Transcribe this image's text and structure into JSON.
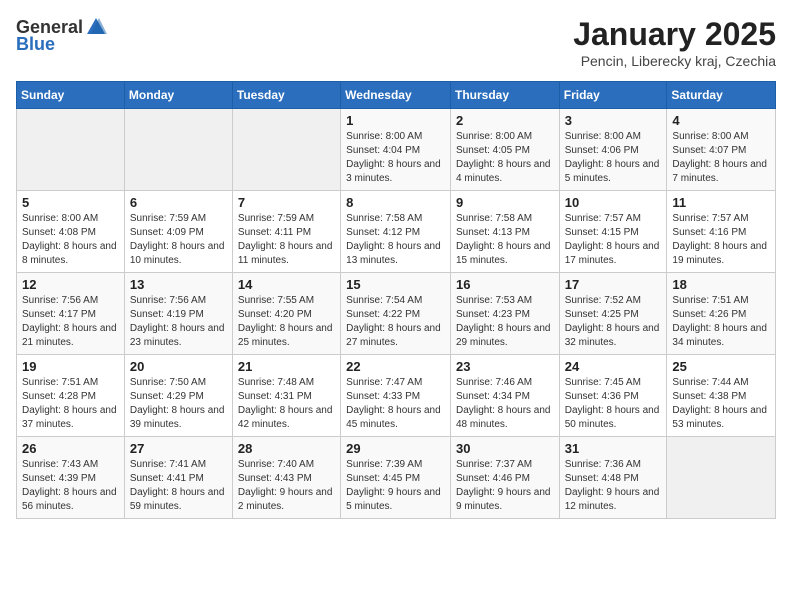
{
  "header": {
    "logo_general": "General",
    "logo_blue": "Blue",
    "month_title": "January 2025",
    "subtitle": "Pencin, Liberecky kraj, Czechia"
  },
  "weekdays": [
    "Sunday",
    "Monday",
    "Tuesday",
    "Wednesday",
    "Thursday",
    "Friday",
    "Saturday"
  ],
  "weeks": [
    [
      {
        "day": "",
        "info": ""
      },
      {
        "day": "",
        "info": ""
      },
      {
        "day": "",
        "info": ""
      },
      {
        "day": "1",
        "info": "Sunrise: 8:00 AM\nSunset: 4:04 PM\nDaylight: 8 hours and 3 minutes."
      },
      {
        "day": "2",
        "info": "Sunrise: 8:00 AM\nSunset: 4:05 PM\nDaylight: 8 hours and 4 minutes."
      },
      {
        "day": "3",
        "info": "Sunrise: 8:00 AM\nSunset: 4:06 PM\nDaylight: 8 hours and 5 minutes."
      },
      {
        "day": "4",
        "info": "Sunrise: 8:00 AM\nSunset: 4:07 PM\nDaylight: 8 hours and 7 minutes."
      }
    ],
    [
      {
        "day": "5",
        "info": "Sunrise: 8:00 AM\nSunset: 4:08 PM\nDaylight: 8 hours and 8 minutes."
      },
      {
        "day": "6",
        "info": "Sunrise: 7:59 AM\nSunset: 4:09 PM\nDaylight: 8 hours and 10 minutes."
      },
      {
        "day": "7",
        "info": "Sunrise: 7:59 AM\nSunset: 4:11 PM\nDaylight: 8 hours and 11 minutes."
      },
      {
        "day": "8",
        "info": "Sunrise: 7:58 AM\nSunset: 4:12 PM\nDaylight: 8 hours and 13 minutes."
      },
      {
        "day": "9",
        "info": "Sunrise: 7:58 AM\nSunset: 4:13 PM\nDaylight: 8 hours and 15 minutes."
      },
      {
        "day": "10",
        "info": "Sunrise: 7:57 AM\nSunset: 4:15 PM\nDaylight: 8 hours and 17 minutes."
      },
      {
        "day": "11",
        "info": "Sunrise: 7:57 AM\nSunset: 4:16 PM\nDaylight: 8 hours and 19 minutes."
      }
    ],
    [
      {
        "day": "12",
        "info": "Sunrise: 7:56 AM\nSunset: 4:17 PM\nDaylight: 8 hours and 21 minutes."
      },
      {
        "day": "13",
        "info": "Sunrise: 7:56 AM\nSunset: 4:19 PM\nDaylight: 8 hours and 23 minutes."
      },
      {
        "day": "14",
        "info": "Sunrise: 7:55 AM\nSunset: 4:20 PM\nDaylight: 8 hours and 25 minutes."
      },
      {
        "day": "15",
        "info": "Sunrise: 7:54 AM\nSunset: 4:22 PM\nDaylight: 8 hours and 27 minutes."
      },
      {
        "day": "16",
        "info": "Sunrise: 7:53 AM\nSunset: 4:23 PM\nDaylight: 8 hours and 29 minutes."
      },
      {
        "day": "17",
        "info": "Sunrise: 7:52 AM\nSunset: 4:25 PM\nDaylight: 8 hours and 32 minutes."
      },
      {
        "day": "18",
        "info": "Sunrise: 7:51 AM\nSunset: 4:26 PM\nDaylight: 8 hours and 34 minutes."
      }
    ],
    [
      {
        "day": "19",
        "info": "Sunrise: 7:51 AM\nSunset: 4:28 PM\nDaylight: 8 hours and 37 minutes."
      },
      {
        "day": "20",
        "info": "Sunrise: 7:50 AM\nSunset: 4:29 PM\nDaylight: 8 hours and 39 minutes."
      },
      {
        "day": "21",
        "info": "Sunrise: 7:48 AM\nSunset: 4:31 PM\nDaylight: 8 hours and 42 minutes."
      },
      {
        "day": "22",
        "info": "Sunrise: 7:47 AM\nSunset: 4:33 PM\nDaylight: 8 hours and 45 minutes."
      },
      {
        "day": "23",
        "info": "Sunrise: 7:46 AM\nSunset: 4:34 PM\nDaylight: 8 hours and 48 minutes."
      },
      {
        "day": "24",
        "info": "Sunrise: 7:45 AM\nSunset: 4:36 PM\nDaylight: 8 hours and 50 minutes."
      },
      {
        "day": "25",
        "info": "Sunrise: 7:44 AM\nSunset: 4:38 PM\nDaylight: 8 hours and 53 minutes."
      }
    ],
    [
      {
        "day": "26",
        "info": "Sunrise: 7:43 AM\nSunset: 4:39 PM\nDaylight: 8 hours and 56 minutes."
      },
      {
        "day": "27",
        "info": "Sunrise: 7:41 AM\nSunset: 4:41 PM\nDaylight: 8 hours and 59 minutes."
      },
      {
        "day": "28",
        "info": "Sunrise: 7:40 AM\nSunset: 4:43 PM\nDaylight: 9 hours and 2 minutes."
      },
      {
        "day": "29",
        "info": "Sunrise: 7:39 AM\nSunset: 4:45 PM\nDaylight: 9 hours and 5 minutes."
      },
      {
        "day": "30",
        "info": "Sunrise: 7:37 AM\nSunset: 4:46 PM\nDaylight: 9 hours and 9 minutes."
      },
      {
        "day": "31",
        "info": "Sunrise: 7:36 AM\nSunset: 4:48 PM\nDaylight: 9 hours and 12 minutes."
      },
      {
        "day": "",
        "info": ""
      }
    ]
  ]
}
